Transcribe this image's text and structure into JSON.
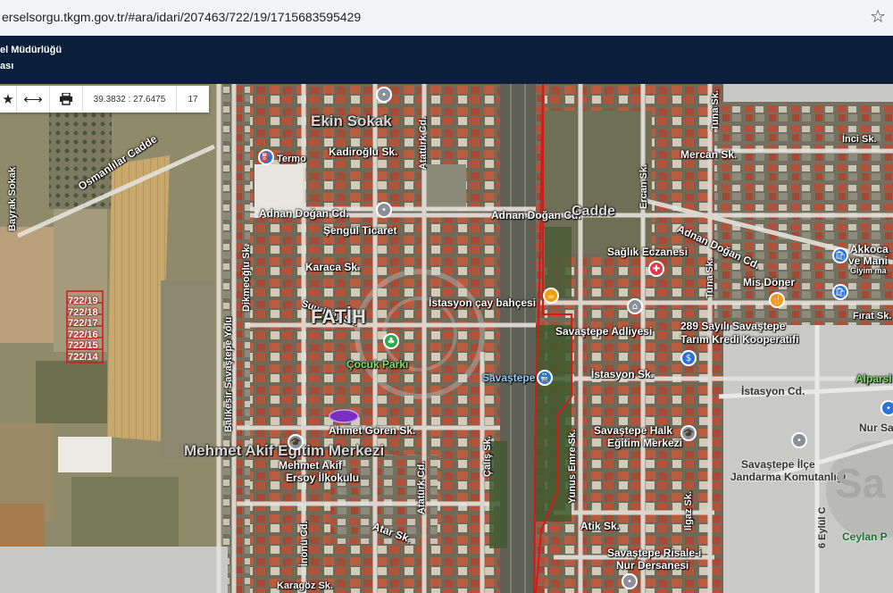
{
  "browser": {
    "url": "erselsorgu.tkgm.gov.tr/#ara/idari/207463/722/19/1715683595429",
    "bookmark_icon": "star-icon"
  },
  "header": {
    "line1": "el Müdürlüğü",
    "line2": "ası"
  },
  "toolbar": {
    "favorite_icon": "star-icon",
    "measure_icon": "arrows-horizontal-icon",
    "print_icon": "printer-icon",
    "coordinates": "39.3832 : 27.6475",
    "zoom": "17"
  },
  "map": {
    "streets": {
      "ekin": "Ekin Sokak",
      "kadiroglu": "Kadiroğlu Sk.",
      "ataturk1": "Atatürk Cd.",
      "ataturk2": "Atatürk Cd.",
      "adnan1": "Adnan Doğan Cd.",
      "adnan2": "Adnan Doğan Cd.",
      "adnan3": "Adnan Doğan Cd.",
      "adnan4": "Adnan Doğan Cd.",
      "karaca": "Karaca Sk.",
      "suuribey": "Suuribey Sk.",
      "istasyon1": "İstasyon Sk.",
      "istasyon2": "İstasyon Cd.",
      "ahmetgoren": "Ahmet Gören Sk.",
      "atar": "Atar Sk.",
      "inonu": "İnönü Cd.",
      "calis": "Çalış Sk.",
      "yunusemre": "Yunus Emre Sk.",
      "atik": "Atik Sk.",
      "ilgaz": "Ilgaz Sk.",
      "mercan": "Mercan Sk.",
      "tuna1": "Tuna Sk.",
      "tuna2": "Tuna Sk.",
      "inci": "İnci Sk.",
      "ercan": "Ercan Sk.",
      "firat": "Fırat Sk.",
      "bayrak": "Bayrak Sokak",
      "osmanlilar": "Osmanlılar Cadde",
      "dikmeoglu": "Dikmeoğlu Sk.",
      "balikesir": "Balıkesir Savaştepe Yolu",
      "eylul": "6 Eylül C",
      "karagoz": "Karagöz Sk.",
      "mahcadde": "Cadde"
    },
    "pois": {
      "termo": "Termo",
      "sengul": "Şengül Ticaret",
      "istasyon_cay": "İstasyon çay bahçesi",
      "saglik": "Sağlık Eczanesi",
      "mis_doner": "Mis Döner",
      "adliye": "Savaştepe Adliyesi",
      "kooperatif_1": "289 Sayılı Savaştepe",
      "kooperatif_2": "Tarım Kredi Kooperatifi",
      "cocuk_parki": "Çocuk Parkı",
      "savastepe": "Savaştepe",
      "halk_egitim_1": "Savaştepe Halk",
      "halk_egitim_2": "Eğitim Merkezi",
      "mae_merkezi": "Mehmet Akif Eğitim Merkezi",
      "mae_ilkokulu_1": "Mehmet Akif",
      "mae_ilkokulu_2": "Ersoy İlkokulu",
      "jandarma_1": "Savaştepe İlçe",
      "jandarma_2": "Jandarma Komutanlığı",
      "akkoca_1": "Akkoca",
      "akkoca_2": "ve Mani",
      "akkoca_3": "Giyim ma",
      "alpars": "Alparsl",
      "nursav": "Nur Sav",
      "ceylan": "Ceylan P",
      "risale_1": "Savaştepe Risale-i",
      "risale_2": "Nur Dersanesi",
      "fatih": "FATİH",
      "sa": "Sa"
    },
    "parcels": [
      "722/19",
      "722/18",
      "722/17",
      "722/16",
      "722/15",
      "722/14"
    ]
  },
  "colors": {
    "header_bg": "#0b1f3a",
    "parcel_outline": "#d11a1a",
    "poi_blue": "#2b73d8",
    "poi_orange": "#f29a1a",
    "poi_green": "#2ea84a",
    "poi_red": "#e2384a"
  }
}
